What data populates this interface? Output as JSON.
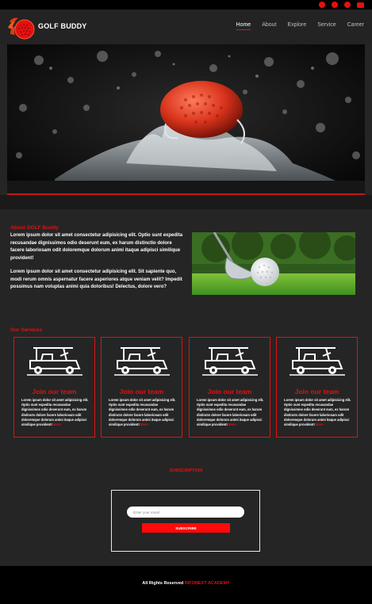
{
  "header": {
    "brand": "GOLF BUDDY",
    "nav": [
      {
        "label": "Home",
        "active": true
      },
      {
        "label": "About",
        "active": false
      },
      {
        "label": "Explore",
        "active": false
      },
      {
        "label": "Service",
        "active": false
      },
      {
        "label": "Career",
        "active": false
      }
    ],
    "social_icons": [
      "facebook-icon",
      "twitter-icon",
      "instagram-icon",
      "youtube-icon"
    ]
  },
  "colors": {
    "accent": "#e41010",
    "background": "#252525",
    "footer": "#000000"
  },
  "about": {
    "title": "About GOLF Buddy",
    "para1": "Lorem ipsum dolor sit amet consectetur adipisicing elit. Optio sunt expedita recusandae dignissimos odio deserunt eum, ex harum distinctio dolore facere laboriosam odit doloremque dolorum animi itaque adipisci similique provident!",
    "para2": "Lorem ipsum dolor sit amet consectetur adipisicing elit. Sit sapiente quo, modi rerum omnis aspernatur facere asperiores atque veniam velit? Impedit possimus nam voluptas animi quia doloribus! Delectus, dolore vero?"
  },
  "services": {
    "title": "Our Services",
    "cards": [
      {
        "title": "Join our team",
        "text": "Lorem ipsum dolor sit amet adipisicing elit. Optio sunt expedita recusandae dignissimos odio deserunt eum, ex harum distincto dolore facere laboriosam odit doloremque dolorum animi itaque adipisci similique provident!",
        "more": "More"
      },
      {
        "title": "Join our team",
        "text": "Lorem ipsum dolor sit amet adipisicing elit. Optio sunt expedita recusandae dignissimos odio deserunt eum, ex harum distincto dolore facere laboriosam odit doloremque dolorum animi itaque adipisci similique provident!",
        "more": "More"
      },
      {
        "title": "Join our team",
        "text": "Lorem ipsum dolor sit amet adipisicing elit. Optio sunt expedita recusandae dignissimos odio deserunt eum, ex harum distincto dolore facere laboriosam odit doloremque dolorum animi itaque adipisci similique provident!",
        "more": "More"
      },
      {
        "title": "Join our team",
        "text": "Lorem ipsum dolor sit amet adipisicing elit. Optio sunt expedita recusandae dignissimos odio deserunt eum, ex harum distincto dolore facere laboriosam odit doloremque dolorum animi itaque adipisci similique provident!",
        "more": "More"
      }
    ]
  },
  "subscription": {
    "title": "SUBSCRIPTION",
    "email_placeholder": "Enter your email",
    "button": "SUBSCRIBE"
  },
  "footer": {
    "text": "All Rights Reserved",
    "brand": "INFONEXT ACADEMY"
  }
}
